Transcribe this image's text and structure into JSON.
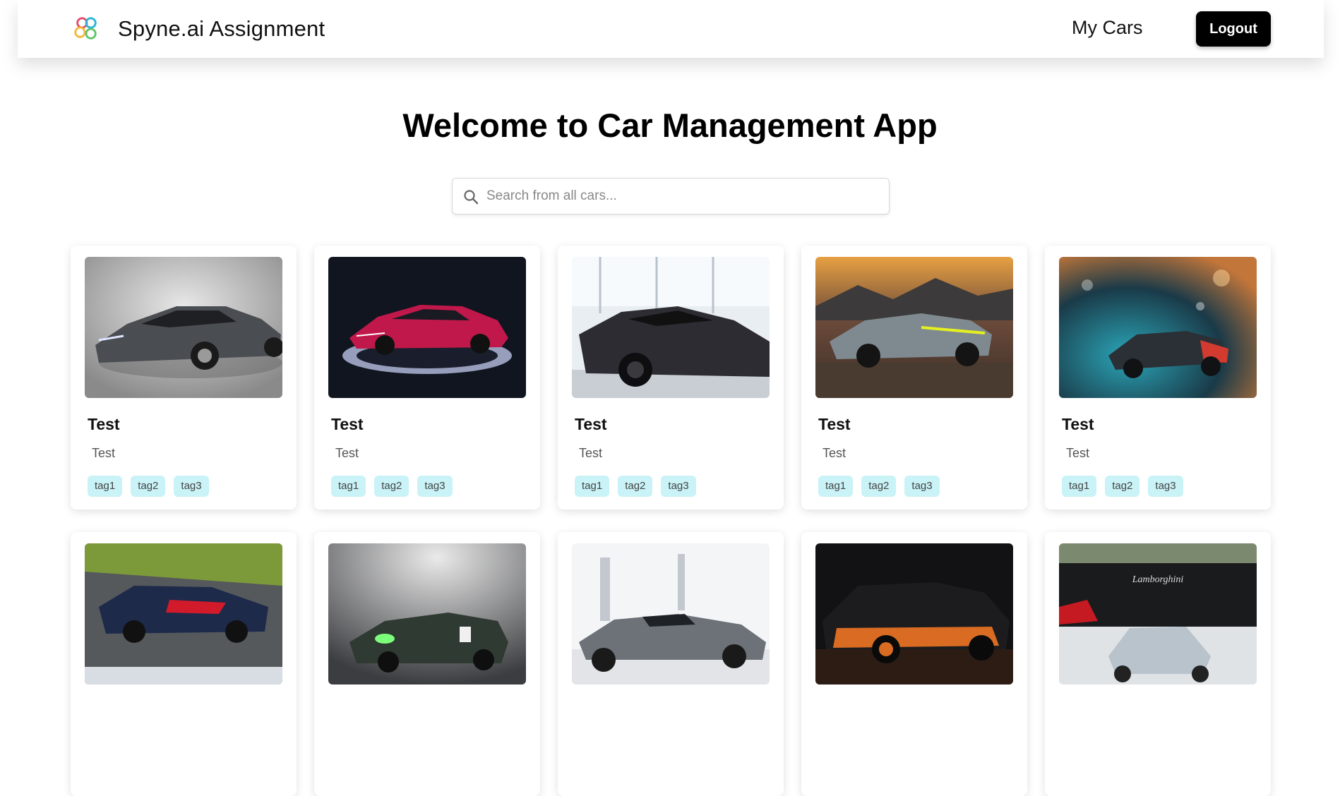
{
  "header": {
    "brand": "Spyne.ai Assignment",
    "nav_my_cars": "My Cars",
    "logout_label": "Logout"
  },
  "main": {
    "heading": "Welcome to Car Management App",
    "search": {
      "placeholder": "Search from all cars...",
      "value": ""
    }
  },
  "cars": [
    {
      "title": "Test",
      "description": "Test",
      "tags": [
        "tag1",
        "tag2",
        "tag3"
      ],
      "image": "grey-supercar-studio"
    },
    {
      "title": "Test",
      "description": "Test",
      "tags": [
        "tag1",
        "tag2",
        "tag3"
      ],
      "image": "red-supercar-dark-stage"
    },
    {
      "title": "Test",
      "description": "Test",
      "tags": [
        "tag1",
        "tag2",
        "tag3"
      ],
      "image": "black-hypercar-showroom"
    },
    {
      "title": "Test",
      "description": "Test",
      "tags": [
        "tag1",
        "tag2",
        "tag3"
      ],
      "image": "green-sportscar-sunset"
    },
    {
      "title": "Test",
      "description": "Test",
      "tags": [
        "tag1",
        "tag2",
        "tag3"
      ],
      "image": "convertible-bokeh-rain"
    },
    {
      "title": "",
      "description": "",
      "tags": [],
      "image": "race-car-track"
    },
    {
      "title": "",
      "description": "",
      "tags": [],
      "image": "green-gt-racer-studio"
    },
    {
      "title": "",
      "description": "",
      "tags": [],
      "image": "silver-hypercar-garage"
    },
    {
      "title": "",
      "description": "",
      "tags": [],
      "image": "black-orange-hypercar"
    },
    {
      "title": "",
      "description": "",
      "tags": [],
      "image": "lamborghini-event"
    }
  ],
  "colors": {
    "tag_bg": "#c9f3f7",
    "logout_bg": "#000000",
    "accent_logo": [
      "#e64a6a",
      "#29b6d6",
      "#f4b73b",
      "#5fc46b"
    ]
  }
}
